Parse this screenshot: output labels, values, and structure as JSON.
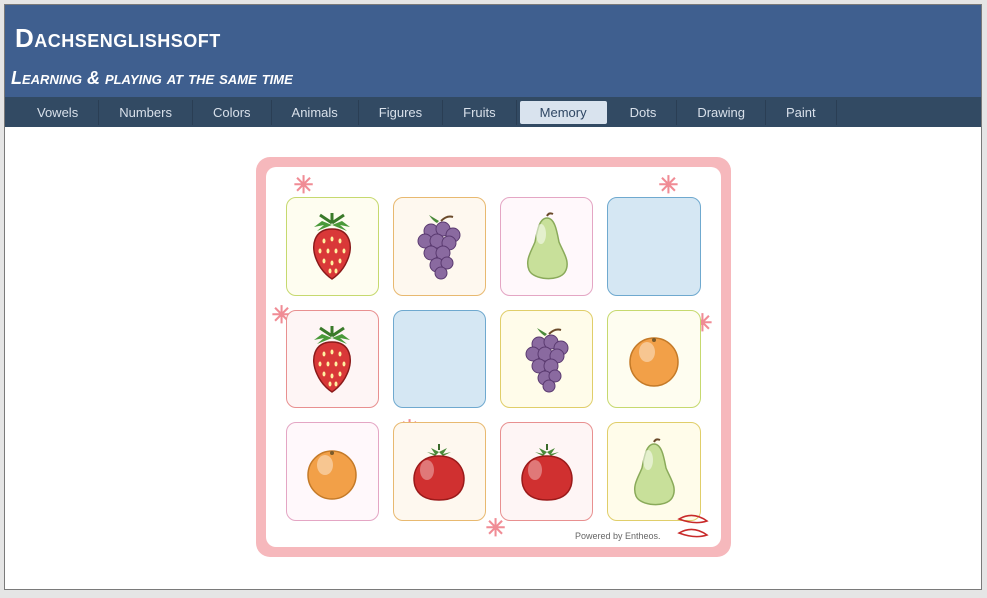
{
  "header": {
    "title": "Dachsenglishsoft",
    "subtitle": "Learning & playing at the same time"
  },
  "nav": {
    "items": [
      {
        "label": "Vowels",
        "active": false
      },
      {
        "label": "Numbers",
        "active": false
      },
      {
        "label": "Colors",
        "active": false
      },
      {
        "label": "Animals",
        "active": false
      },
      {
        "label": "Figures",
        "active": false
      },
      {
        "label": "Fruits",
        "active": false
      },
      {
        "label": "Memory",
        "active": true
      },
      {
        "label": "Dots",
        "active": false
      },
      {
        "label": "Drawing",
        "active": false
      },
      {
        "label": "Paint",
        "active": false
      }
    ]
  },
  "board": {
    "footer": "Powered by Entheos.",
    "cards": [
      {
        "fruit": "strawberry",
        "color": "green"
      },
      {
        "fruit": "grapes",
        "color": "orange"
      },
      {
        "fruit": "pear",
        "color": "blue"
      },
      {
        "fruit": "hidden",
        "color": "hidden"
      },
      {
        "fruit": "strawberry",
        "color": "red"
      },
      {
        "fruit": "hidden",
        "color": "hidden"
      },
      {
        "fruit": "grapes",
        "color": "yellow"
      },
      {
        "fruit": "orange",
        "color": "green"
      },
      {
        "fruit": "orange",
        "color": "blue"
      },
      {
        "fruit": "tomato",
        "color": "orange"
      },
      {
        "fruit": "tomato",
        "color": "red"
      },
      {
        "fruit": "pear",
        "color": "yellow"
      }
    ]
  }
}
